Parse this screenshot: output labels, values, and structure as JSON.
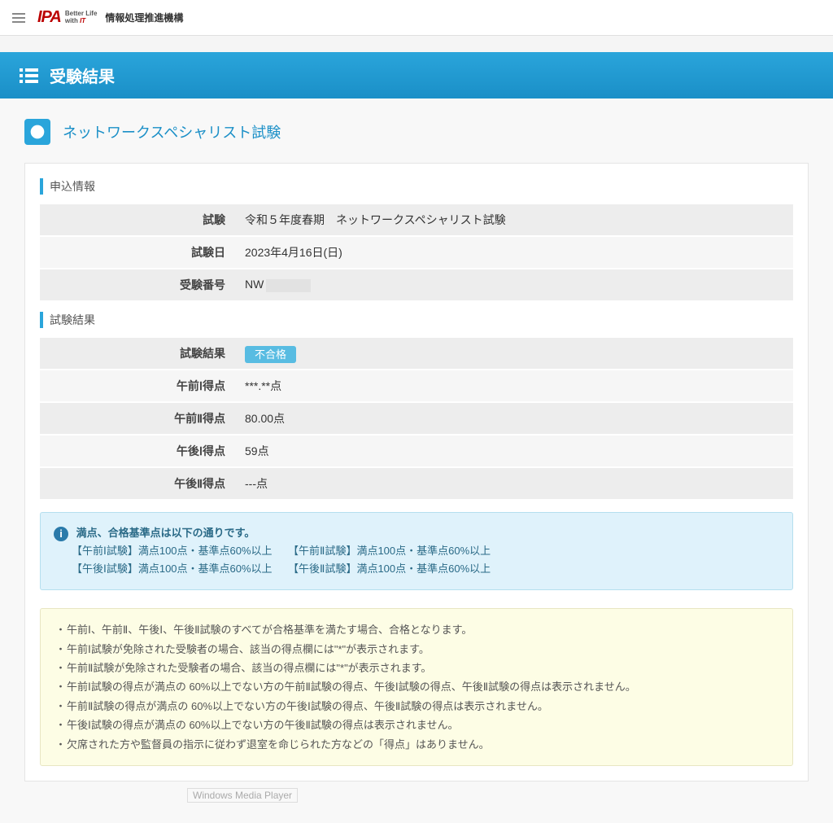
{
  "header": {
    "logo_main": "IPA",
    "logo_sub_top": "Better Life",
    "logo_sub_bot_prefix": "with ",
    "logo_sub_bot_it": "IT",
    "org_name": "情報処理推進機構"
  },
  "page_title": "受験結果",
  "exam_title": "ネットワークスペシャリスト試験",
  "sections": {
    "application": {
      "heading": "申込情報",
      "rows": [
        {
          "label": "試験",
          "value": "令和５年度春期　ネットワークスペシャリスト試験"
        },
        {
          "label": "試験日",
          "value": "2023年4月16日(日)"
        }
      ],
      "exam_number_label": "受験番号",
      "exam_number_prefix": "NW"
    },
    "result": {
      "heading": "試験結果",
      "result_label": "試験結果",
      "result_badge": "不合格",
      "scores": [
        {
          "label": "午前Ⅰ得点",
          "value": "***.**点"
        },
        {
          "label": "午前Ⅱ得点",
          "value": "80.00点"
        },
        {
          "label": "午後Ⅰ得点",
          "value": "59点"
        },
        {
          "label": "午後Ⅱ得点",
          "value": "---点"
        }
      ]
    }
  },
  "info_box": {
    "heading": "満点、合格基準点は以下の通りです。",
    "lines": [
      "【午前Ⅰ試験】満点100点・基準点60%以上　　【午前Ⅱ試験】満点100点・基準点60%以上",
      "【午後Ⅰ試験】満点100点・基準点60%以上　　【午後Ⅱ試験】満点100点・基準点60%以上"
    ]
  },
  "notes": [
    "午前Ⅰ、午前Ⅱ、午後Ⅰ、午後Ⅱ試験のすべてが合格基準を満たす場合、合格となります。",
    "午前Ⅰ試験が免除された受験者の場合、該当の得点欄には\"*\"が表示されます。",
    "午前Ⅱ試験が免除された受験者の場合、該当の得点欄には\"*\"が表示されます。",
    "午前Ⅰ試験の得点が満点の 60%以上でない方の午前Ⅱ試験の得点、午後Ⅰ試験の得点、午後Ⅱ試験の得点は表示されません。",
    "午前Ⅱ試験の得点が満点の 60%以上でない方の午後Ⅰ試験の得点、午後Ⅱ試験の得点は表示されません。",
    "午後Ⅰ試験の得点が満点の 60%以上でない方の午後Ⅱ試験の得点は表示されません。",
    "欠席された方や監督員の指示に従わず退室を命じられた方などの「得点」はありません。"
  ],
  "bottom_label": "Windows Media Player"
}
